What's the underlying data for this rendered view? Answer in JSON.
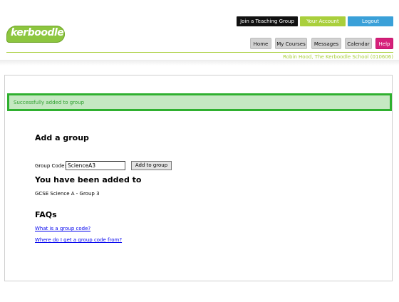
{
  "logo": {
    "text": "kerboodle"
  },
  "top_buttons": {
    "join": "Join a Teaching Group",
    "account": "Your Account",
    "logout": "Logout"
  },
  "nav": {
    "home": "Home",
    "my_courses": "My Courses",
    "messages": "Messages",
    "calendar": "Calendar",
    "help": "Help"
  },
  "user_info": "Robin Hood, The Kerboodle School (010606)",
  "message": {
    "success": "Successfully added to group"
  },
  "add_group": {
    "heading": "Add a group",
    "code_label": "Group Code:",
    "code_value": "ScienceA3",
    "button": "Add to group"
  },
  "added": {
    "heading": "You have been added to",
    "group": "GCSE Science A - Group 3"
  },
  "faqs": {
    "heading": "FAQs",
    "links": [
      "What is a group code?",
      "Where do I get a group code from?"
    ]
  },
  "colors": {
    "brand_green": "#a9cf3c",
    "success_border": "#2fb02f",
    "logout_blue": "#3aa0d8",
    "help_pink": "#d6207a"
  }
}
